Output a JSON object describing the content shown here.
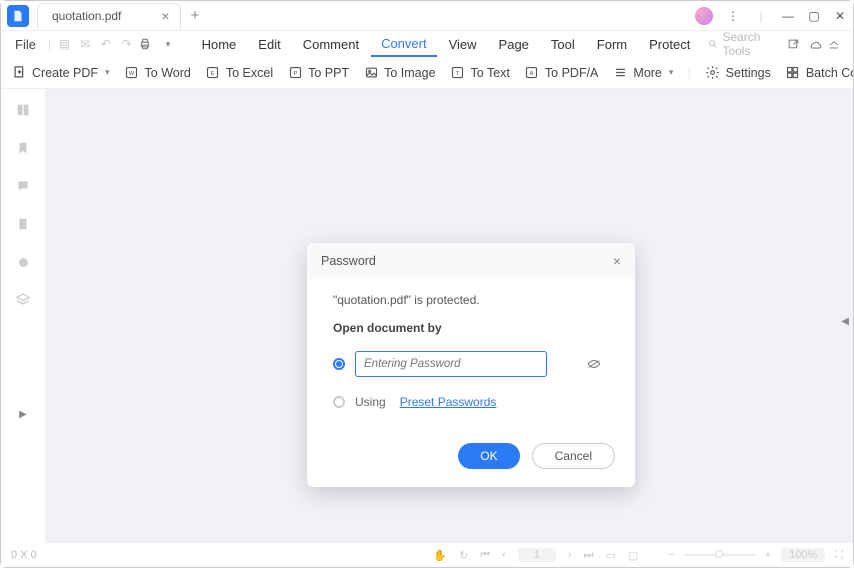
{
  "titlebar": {
    "tab_name": "quotation.pdf"
  },
  "menubar": {
    "file": "File",
    "items": [
      "Home",
      "Edit",
      "Comment",
      "Convert",
      "View",
      "Page",
      "Tool",
      "Form",
      "Protect"
    ],
    "active_index": 3,
    "search_placeholder": "Search Tools"
  },
  "toolbar": {
    "create": "Create PDF",
    "to_word": "To Word",
    "to_excel": "To Excel",
    "to_ppt": "To PPT",
    "to_image": "To Image",
    "to_text": "To Text",
    "to_pdfa": "To PDF/A",
    "more": "More",
    "settings": "Settings",
    "batch": "Batch Conve"
  },
  "dialog": {
    "title": "Password",
    "message": "\"quotation.pdf\" is protected.",
    "subtitle": "Open document by",
    "pw_placeholder": "Entering Password",
    "using": "Using",
    "preset": "Preset Passwords",
    "ok": "OK",
    "cancel": "Cancel"
  },
  "status": {
    "coords": "0 X 0",
    "page": "1",
    "zoom": "100%"
  }
}
